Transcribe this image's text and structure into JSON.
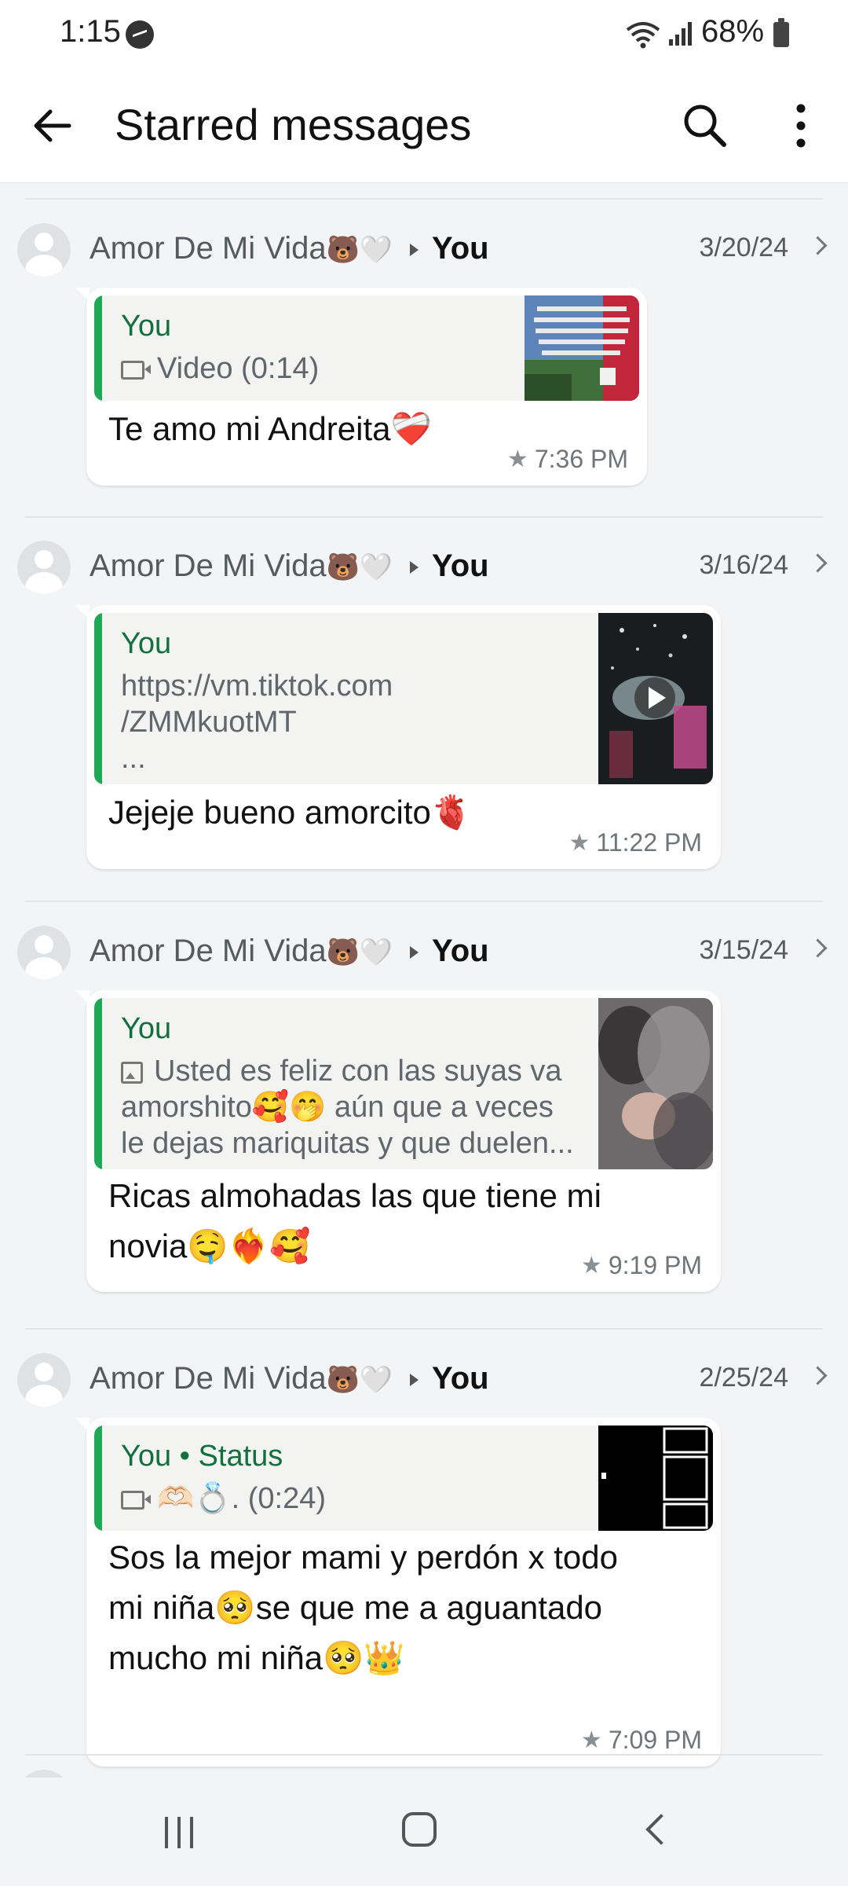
{
  "status_bar": {
    "time": "1:15",
    "battery": "68%",
    "icons": [
      "messenger-icon",
      "wifi-icon",
      "signal-icon",
      "battery-icon"
    ]
  },
  "app_bar": {
    "title": "Starred messages",
    "icons": [
      "back-arrow-icon",
      "search-icon",
      "more-vertical-icon"
    ]
  },
  "messages": [
    {
      "sender": "Amor De Mi Vida",
      "sender_emoji": "🐻🤍",
      "recipient": "You",
      "date": "3/20/24",
      "quote_author": "You",
      "quote_lines": [
        "Video (0:14)"
      ],
      "quote_icon": "video-icon",
      "text_lines": [
        "Te amo mi Andreita❤️‍🩹"
      ],
      "time": "7:36 PM"
    },
    {
      "sender": "Amor De Mi Vida",
      "sender_emoji": "🐻🤍",
      "recipient": "You",
      "date": "3/16/24",
      "quote_author": "You",
      "quote_lines": [
        "https://vm.tiktok.com",
        "/ZMMkuotMT",
        "..."
      ],
      "quote_icon": "play-icon",
      "text_lines": [
        "Jejeje bueno amorcito🫀"
      ],
      "time": "11:22 PM"
    },
    {
      "sender": "Amor De Mi Vida",
      "sender_emoji": "🐻🤍",
      "recipient": "You",
      "date": "3/15/24",
      "quote_author": "You",
      "quote_lines": [
        "Usted es feliz con las suyas va",
        "amorshito🥰🤭 aún que a veces",
        "le dejas mariquitas y que duelen..."
      ],
      "quote_icon": "image-icon",
      "text_lines": [
        "Ricas almohadas las que tiene mi",
        "novia🤤❤️‍🔥🥰"
      ],
      "time": "9:19 PM"
    },
    {
      "sender": "Amor De Mi Vida",
      "sender_emoji": "🐻🤍",
      "recipient": "You",
      "date": "2/25/24",
      "quote_author": "You • Status",
      "quote_lines": [
        "🫶🏻💍. (0:24)"
      ],
      "quote_icon": "video-icon",
      "text_lines": [
        "Sos la mejor mami y perdón x todo",
        "mi niña🥺se que me a aguantado",
        "mucho mi niña🥺👑"
      ],
      "time": "7:09 PM"
    }
  ],
  "nav_bar": {
    "icons": [
      "recents-icon",
      "home-icon",
      "back-icon"
    ]
  }
}
